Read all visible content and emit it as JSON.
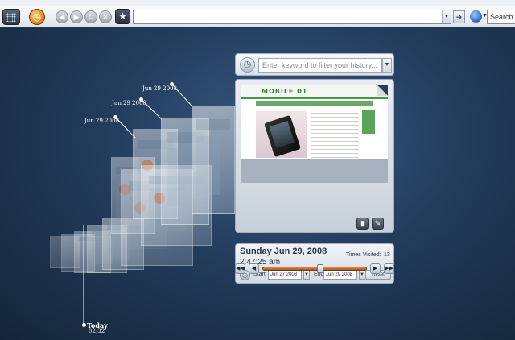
{
  "toolbar": {
    "search_text": "Search th",
    "icons": {
      "grid": "grid-icon",
      "history": "clock-icon",
      "back": "back-icon",
      "forward": "forward-icon",
      "reload": "reload-icon",
      "stop": "stop-icon",
      "bookmark": "star-icon",
      "go": "go-arrow-icon",
      "search_engine": "globe-icon"
    }
  },
  "timeline": {
    "date_labels": [
      "Jun 29 2008",
      "Jun 29 2008",
      "Jun 29 2008"
    ],
    "today_label": "Today",
    "today_time": "02:32",
    "slider_position": 0.55
  },
  "filter": {
    "placeholder": "Enter keyword to filter your history..."
  },
  "preview": {
    "site_logo_text": "MOBILE 01"
  },
  "details": {
    "date": "Sunday Jun 29, 2008",
    "time": "2:47:25 am",
    "visits_label": "Times Visited:",
    "visits_value": "13",
    "start_label": "Start",
    "start_value": "Jun 27 2008",
    "end_label": "End",
    "end_value": "Jun 29 2008",
    "reset_label": "Reset"
  },
  "colors": {
    "background": "#223c5c",
    "accent_orange": "#e07a10",
    "slider_track": "#c06a2c"
  }
}
